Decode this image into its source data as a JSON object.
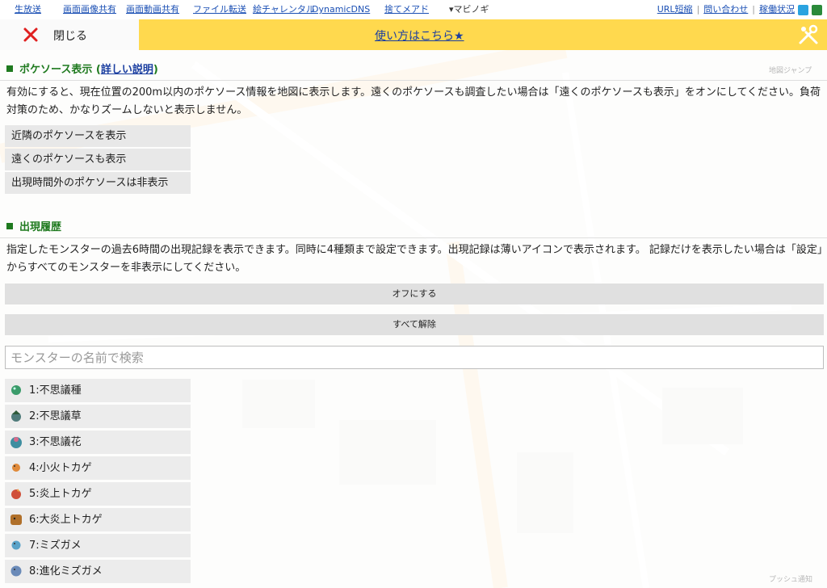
{
  "topbar": {
    "links": [
      "生放送",
      "画面画像共有",
      "画面動画共有",
      "ファイル転送",
      "絵チャレンタル",
      "DynamicDNS",
      "捨てメアド"
    ],
    "dropdown": "▾マビノギ",
    "right_links": [
      "URL短縮",
      "問い合わせ",
      "稼働状況"
    ],
    "separator": "|"
  },
  "header": {
    "close_label": "閉じる",
    "howto_label": "使い方はこちら★"
  },
  "poke_source": {
    "title": "ポケソース表示",
    "link_open": "(",
    "link": "詳しい説明",
    "link_close": ")",
    "description": "有効にすると、現在位置の200m以内のポケソース情報を地図に表示します。遠くのポケソースも調査したい場合は「遠くのポケソースも表示」をオンにしてください。負荷対策のため、かなりズームしないと表示しません。",
    "options": [
      "近隣のポケソースを表示",
      "遠くのポケソースも表示",
      "出現時間外のポケソースは非表示"
    ]
  },
  "history": {
    "title": "出現履歴",
    "description": "指定したモンスターの過去6時間の出現記録を表示できます。同時に4種類まで設定できます。出現記録は薄いアイコンで表示されます。 記録だけを表示したい場合は「設定」からすべてのモンスターを非表示にしてください。",
    "off_button": "オフにする",
    "clear_button": "すべて解除",
    "search_placeholder": "モンスターの名前で検索"
  },
  "monsters": [
    {
      "label": "1:不思議種",
      "color": "#3a9b6a"
    },
    {
      "label": "2:不思議草",
      "color": "#4f7b7a"
    },
    {
      "label": "3:不思議花",
      "color": "#3f8ea0"
    },
    {
      "label": "4:小火トカゲ",
      "color": "#e08a3a"
    },
    {
      "label": "5:炎上トカゲ",
      "color": "#d0503a"
    },
    {
      "label": "6:大炎上トカゲ",
      "color": "#b0702a"
    },
    {
      "label": "7:ミズガメ",
      "color": "#5aa3c8"
    },
    {
      "label": "8:進化ミズガメ",
      "color": "#6a8ab8"
    }
  ],
  "map_labels": {
    "jump": "地図ジャンプ",
    "push": "プッシュ通知"
  },
  "colors": {
    "accent_yellow": "#ffd94e",
    "section_green": "#1f7a1f",
    "link_blue": "#1a3ea0",
    "close_red": "#e02020"
  }
}
